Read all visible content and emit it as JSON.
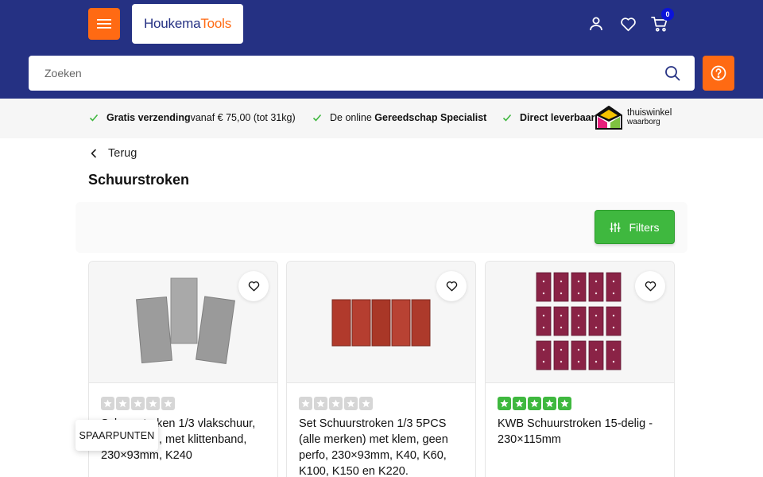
{
  "header": {
    "logo_part1": "Houkema",
    "logo_part2": "Tools",
    "cart_count": "0",
    "colors": {
      "header_bg": "#253183",
      "accent": "#ff6a13",
      "badge": "#0b13d9"
    },
    "icons": [
      "menu-icon",
      "user-icon",
      "heart-icon",
      "cart-icon",
      "search-icon",
      "help-icon"
    ]
  },
  "search": {
    "placeholder": "Zoeken"
  },
  "usps": [
    {
      "bold": "Gratis verzending",
      "rest": " vanaf € 75,00 (tot 31kg)"
    },
    {
      "pre": "De online ",
      "bold": "Gereedschap Specialist"
    },
    {
      "bold": "Direct leverbaar"
    }
  ],
  "trust": {
    "line1": "thuiswinkel",
    "line2": "waarborg"
  },
  "breadcrumb": {
    "back_label": "Terug"
  },
  "page": {
    "title": "Schuurstroken"
  },
  "filters": {
    "label": "Filters",
    "color": "#3fb83f"
  },
  "products": [
    {
      "title": "Schuurstroken 1/3 vlakschuur, 230×93mm, met klittenband, 230×93mm, K240",
      "rating": 0
    },
    {
      "title": "Set Schuurstroken 1/3 5PCS (alle merken) met klem, geen perfo, 230×93mm, K40, K60, K100, K150 en K220.",
      "rating": 0
    },
    {
      "title": "KWB Schuurstroken 15-delig - 230×115mm",
      "rating": 5
    }
  ],
  "loyalty": {
    "label": "SPAARPUNTEN"
  }
}
